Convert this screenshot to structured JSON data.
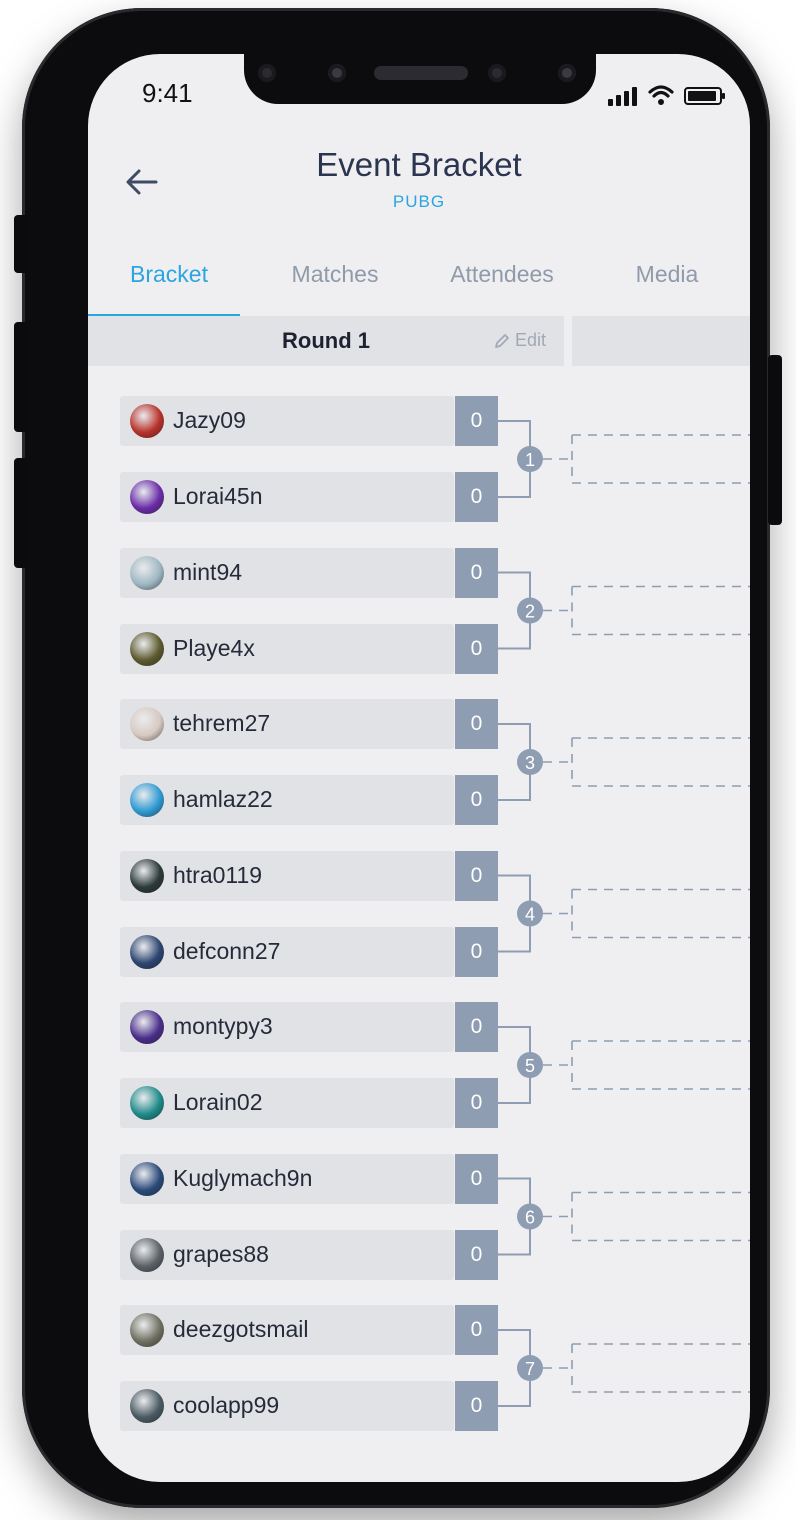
{
  "status_bar": {
    "time": "9:41"
  },
  "header": {
    "title": "Event Bracket",
    "subtitle": "PUBG"
  },
  "tabs": [
    {
      "label": "Bracket",
      "active": true
    },
    {
      "label": "Matches",
      "active": false
    },
    {
      "label": "Attendees",
      "active": false
    },
    {
      "label": "Media",
      "active": false
    }
  ],
  "round": {
    "title": "Round 1",
    "edit_label": "Edit"
  },
  "matches": [
    {
      "number": "1",
      "players": [
        {
          "name": "Jazy09",
          "score": "0",
          "avatar_color": "#b8322b"
        },
        {
          "name": "Lorai45n",
          "score": "0",
          "avatar_color": "#6a2ca8"
        }
      ]
    },
    {
      "number": "2",
      "players": [
        {
          "name": "mint94",
          "score": "0",
          "avatar_color": "#9fb7c2"
        },
        {
          "name": "Playe4x",
          "score": "0",
          "avatar_color": "#5d5a2e"
        }
      ]
    },
    {
      "number": "3",
      "players": [
        {
          "name": "tehrem27",
          "score": "0",
          "avatar_color": "#d8c9c2"
        },
        {
          "name": "hamlaz22",
          "score": "0",
          "avatar_color": "#2f9ad3"
        }
      ]
    },
    {
      "number": "4",
      "players": [
        {
          "name": "htra0119",
          "score": "0",
          "avatar_color": "#2b3a38"
        },
        {
          "name": "defconn27",
          "score": "0",
          "avatar_color": "#2d4570"
        }
      ]
    },
    {
      "number": "5",
      "players": [
        {
          "name": "montypy3",
          "score": "0",
          "avatar_color": "#4a2e8a"
        },
        {
          "name": "Lorain02",
          "score": "0",
          "avatar_color": "#1f8a8a"
        }
      ]
    },
    {
      "number": "6",
      "players": [
        {
          "name": "Kuglymach9n",
          "score": "0",
          "avatar_color": "#2b4a7a"
        },
        {
          "name": "grapes88",
          "score": "0",
          "avatar_color": "#5b6166"
        }
      ]
    },
    {
      "number": "7",
      "players": [
        {
          "name": "deezgotsmail",
          "score": "0",
          "avatar_color": "#6f7060"
        },
        {
          "name": "coolapp99",
          "score": "0",
          "avatar_color": "#4a5a62"
        }
      ]
    }
  ],
  "colors": {
    "accent": "#2aa5e0",
    "score_box": "#8e9db2",
    "connector": "#8e9db2",
    "title": "#2c3550"
  }
}
